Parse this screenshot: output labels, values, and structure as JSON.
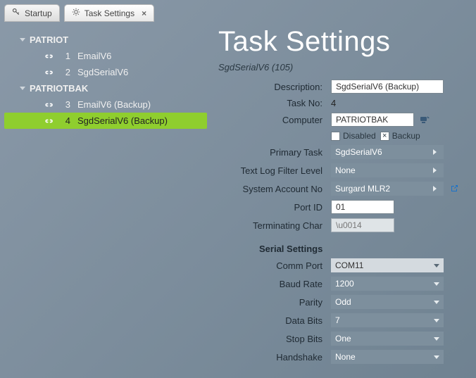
{
  "tabs": {
    "startup": "Startup",
    "settings": "Task Settings"
  },
  "tree": {
    "group1": {
      "name": "PATRIOT",
      "items": [
        {
          "idx": "1",
          "label": "EmailV6"
        },
        {
          "idx": "2",
          "label": "SgdSerialV6"
        }
      ]
    },
    "group2": {
      "name": "PATRIOTBAK",
      "items": [
        {
          "idx": "3",
          "label": "EmailV6 (Backup)"
        },
        {
          "idx": "4",
          "label": "SgdSerialV6 (Backup)"
        }
      ]
    }
  },
  "panel": {
    "title": "Task Settings",
    "subtitle": "SgdSerialV6 (105)",
    "labels": {
      "description": "Description:",
      "taskno": "Task No:",
      "computer": "Computer",
      "disabled": "Disabled",
      "backup": "Backup",
      "primary": "Primary Task",
      "loglevel": "Text Log Filter Level",
      "account": "System Account No",
      "portid": "Port ID",
      "term": "Terminating Char",
      "section": "Serial Settings",
      "comm": "Comm Port",
      "baud": "Baud Rate",
      "parity": "Parity",
      "databits": "Data Bits",
      "stopbits": "Stop Bits",
      "handshake": "Handshake"
    },
    "values": {
      "description": "SgdSerialV6 (Backup)",
      "taskno": "4",
      "computer": "PATRIOTBAK",
      "backup_checked": "×",
      "primary": "SgdSerialV6",
      "loglevel": "None",
      "account": "Surgard MLR2",
      "portid": "01",
      "term": "\\u0014",
      "comm": "COM11",
      "baud": "1200",
      "parity": "Odd",
      "databits": "7",
      "stopbits": "One",
      "handshake": "None"
    }
  }
}
